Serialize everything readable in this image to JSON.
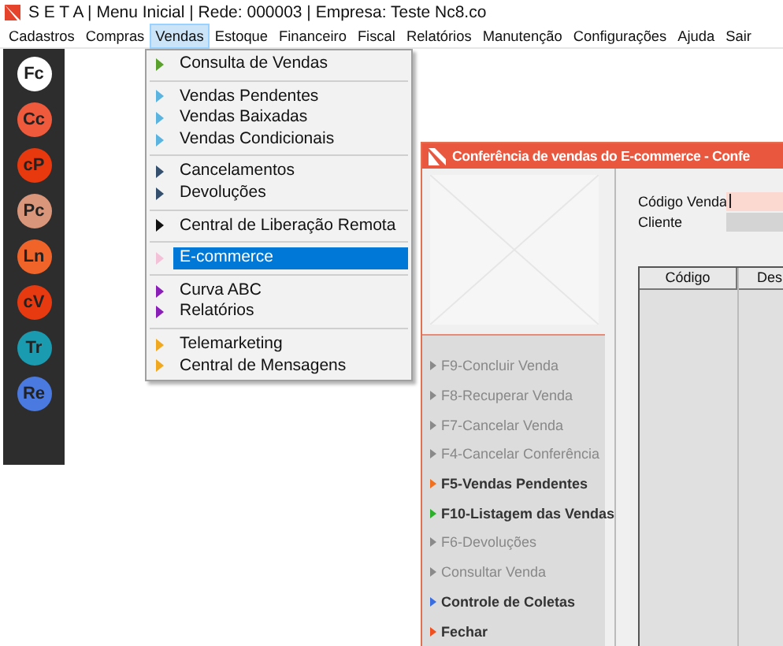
{
  "window": {
    "title": "S E T A | Menu Inicial | Rede: 000003 | Empresa: Teste Nc8.co"
  },
  "menu_bar": [
    {
      "label": "Cadastros",
      "selected": false
    },
    {
      "label": "Compras",
      "selected": false
    },
    {
      "label": "Vendas",
      "selected": true
    },
    {
      "label": "Estoque",
      "selected": false
    },
    {
      "label": "Financeiro",
      "selected": false
    },
    {
      "label": "Fiscal",
      "selected": false
    },
    {
      "label": "Relatórios",
      "selected": false
    },
    {
      "label": "Manutenção",
      "selected": false
    },
    {
      "label": "Configurações",
      "selected": false
    },
    {
      "label": "Ajuda",
      "selected": false
    },
    {
      "label": "Sair",
      "selected": false
    }
  ],
  "sidebar": {
    "items": [
      {
        "label": "Fc",
        "color": "#ffffff"
      },
      {
        "label": "Cc",
        "color": "#f05a3c"
      },
      {
        "label": "cP",
        "color": "#e8380d"
      },
      {
        "label": "Pc",
        "color": "#d9967a"
      },
      {
        "label": "Ln",
        "color": "#f0642a"
      },
      {
        "label": "cV",
        "color": "#e83a10"
      },
      {
        "label": "Tr",
        "color": "#1a9bb0"
      },
      {
        "label": "Re",
        "color": "#4a7ae0"
      }
    ]
  },
  "vendas_menu": {
    "groups": [
      {
        "items": [
          {
            "label": "Consulta de Vendas",
            "color": "#5aa02c",
            "selected": false
          }
        ]
      },
      {
        "items": [
          {
            "label": "Vendas Pendentes",
            "color": "#5bb4e0",
            "selected": false
          },
          {
            "label": "Vendas Baixadas",
            "color": "#5bb4e0",
            "selected": false
          },
          {
            "label": "Vendas Condicionais",
            "color": "#5bb4e0",
            "selected": false
          }
        ]
      },
      {
        "items": [
          {
            "label": "Cancelamentos",
            "color": "#34506e",
            "selected": false
          },
          {
            "label": "Devoluções",
            "color": "#34506e",
            "selected": false
          }
        ]
      },
      {
        "items": [
          {
            "label": "Central de Liberação Remota",
            "color": "#111111",
            "selected": false
          }
        ]
      },
      {
        "items": [
          {
            "label": "E-commerce",
            "color": "#f4c2d8",
            "selected": true
          }
        ]
      },
      {
        "items": [
          {
            "label": "Curva ABC",
            "color": "#8a1fb8",
            "selected": false
          },
          {
            "label": "Relatórios",
            "color": "#8a1fb8",
            "selected": false
          }
        ]
      },
      {
        "items": [
          {
            "label": "Telemarketing",
            "color": "#f0a820",
            "selected": false
          },
          {
            "label": "Central de Mensagens",
            "color": "#f0a820",
            "selected": false
          }
        ]
      }
    ]
  },
  "ecommerce_window": {
    "title": "Conferência de vendas do E-commerce - Confe",
    "actions": [
      {
        "label": "F9-Concluir Venda",
        "disabled": true,
        "color": "#8a8a8a"
      },
      {
        "label": "F8-Recuperar Venda",
        "disabled": true,
        "color": "#8a8a8a"
      },
      {
        "label": "F7-Cancelar Venda",
        "disabled": true,
        "color": "#8a8a8a"
      },
      {
        "label": "F4-Cancelar Conferência",
        "disabled": true,
        "color": "#8a8a8a"
      },
      {
        "label": "F5-Vendas Pendentes",
        "disabled": false,
        "color": "#f07020"
      },
      {
        "label": "F10-Listagem das Vendas",
        "disabled": false,
        "color": "#2cb02c"
      },
      {
        "label": "F6-Devoluções",
        "disabled": true,
        "color": "#8a8a8a"
      },
      {
        "label": "Consultar Venda",
        "disabled": true,
        "color": "#8a8a8a"
      },
      {
        "label": "Controle de Coletas",
        "disabled": false,
        "color": "#3a6ee0"
      },
      {
        "label": "Fechar",
        "disabled": false,
        "color": "#f05020"
      }
    ],
    "fields": [
      {
        "label": "Código Venda",
        "kind": "input"
      },
      {
        "label": "Cliente",
        "kind": "readonly"
      }
    ],
    "table": {
      "columns": [
        "Código",
        "Des"
      ]
    }
  }
}
